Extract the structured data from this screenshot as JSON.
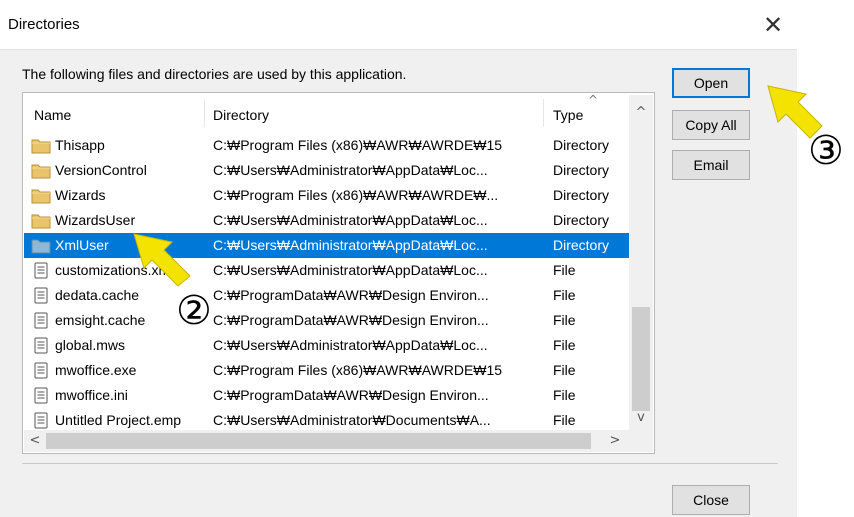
{
  "window": {
    "title": "Directories",
    "close_glyph": "✕"
  },
  "description": "The following files and directories are used by this application.",
  "columns": {
    "name": "Name",
    "directory": "Directory",
    "type": "Type"
  },
  "rows": [
    {
      "name": "Thisapp",
      "directory": "C:₩Program Files (x86)₩AWR₩AWRDE₩15",
      "type": "Directory",
      "icon": "folder-icon",
      "selected": false
    },
    {
      "name": "VersionControl",
      "directory": "C:₩Users₩Administrator₩AppData₩Loc...",
      "type": "Directory",
      "icon": "folder-icon",
      "selected": false
    },
    {
      "name": "Wizards",
      "directory": "C:₩Program Files (x86)₩AWR₩AWRDE₩...",
      "type": "Directory",
      "icon": "folder-icon",
      "selected": false
    },
    {
      "name": "WizardsUser",
      "directory": "C:₩Users₩Administrator₩AppData₩Loc...",
      "type": "Directory",
      "icon": "folder-icon",
      "selected": false
    },
    {
      "name": "XmlUser",
      "directory": "C:₩Users₩Administrator₩AppData₩Loc...",
      "type": "Directory",
      "icon": "folder-icon",
      "selected": true
    },
    {
      "name": "customizations.xml",
      "directory": "C:₩Users₩Administrator₩AppData₩Loc...",
      "type": "File",
      "icon": "file-icon",
      "selected": false
    },
    {
      "name": "dedata.cache",
      "directory": "C:₩ProgramData₩AWR₩Design Environ...",
      "type": "File",
      "icon": "file-icon",
      "selected": false
    },
    {
      "name": "emsight.cache",
      "directory": "C:₩ProgramData₩AWR₩Design Environ...",
      "type": "File",
      "icon": "file-icon",
      "selected": false
    },
    {
      "name": "global.mws",
      "directory": "C:₩Users₩Administrator₩AppData₩Loc...",
      "type": "File",
      "icon": "file-icon",
      "selected": false
    },
    {
      "name": "mwoffice.exe",
      "directory": "C:₩Program Files (x86)₩AWR₩AWRDE₩15",
      "type": "File",
      "icon": "file-icon",
      "selected": false
    },
    {
      "name": "mwoffice.ini",
      "directory": "C:₩ProgramData₩AWR₩Design Environ...",
      "type": "File",
      "icon": "file-icon",
      "selected": false
    },
    {
      "name": "Untitled Project.emp",
      "directory": "C:₩Users₩Administrator₩Documents₩A...",
      "type": "File",
      "icon": "file-icon",
      "selected": false
    }
  ],
  "buttons": {
    "open": "Open",
    "copy_all": "Copy All",
    "email": "Email",
    "close": "Close"
  },
  "callouts": {
    "step2": "②",
    "step3": "③"
  },
  "colors": {
    "selection": "#0078d7",
    "arrow": "#f4e300"
  }
}
